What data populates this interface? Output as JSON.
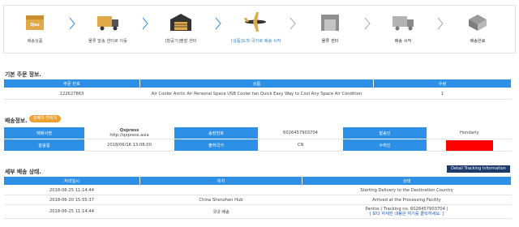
{
  "steps": [
    {
      "label": "배송상품",
      "state": "done",
      "icon": "qoo10-box-icon"
    },
    {
      "label": "물류 발송 센터로 이동",
      "state": "done",
      "icon": "delivery-truck-icon"
    },
    {
      "label": "[항공기]출발 센터",
      "state": "done",
      "icon": "warehouse-icon"
    },
    {
      "label": "[상품]도착 국가로 배송 시작",
      "state": "done",
      "icon": "airplane-icon"
    },
    {
      "label": "물류 센터",
      "state": "pending",
      "icon": "distribution-center-icon"
    },
    {
      "label": "배송 시작",
      "state": "pending",
      "icon": "delivery-truck-icon"
    },
    {
      "label": "배송완료",
      "state": "pending",
      "icon": "delivered-box-icon"
    }
  ],
  "order_section": {
    "title": "기본 주문 정보.",
    "headers": [
      "주문 번호",
      "상품",
      "수량"
    ],
    "row": [
      "122627863",
      "Air Cooler Arctic Air Personal Space USB Cooler fan Quick Easy Way to Cool Any Space Air Condition",
      "1"
    ]
  },
  "delivery_info": {
    "title": "배송정보.",
    "badge": "판매자 연락처",
    "carrier_label": "택배사명",
    "carrier_name": "Qxpress",
    "carrier_url": "http://qxpress.asia",
    "tracking_label": "송장번호",
    "tracking_no": "6026457903704",
    "sender_label": "발송인",
    "sender_value": "Hondarly",
    "ship_date_label": "발송일",
    "ship_date": "2018/06/16 13:08:00",
    "origin_label": "출하국가",
    "origin": "CN",
    "recipient_label": "수취인"
  },
  "status_section": {
    "title": "세부 배송 상태.",
    "detail_button": "Detail Tracking Information",
    "headers": [
      "처리일시",
      "위치",
      "상태"
    ],
    "rows": [
      {
        "time": "2018-06-25 11:14:44",
        "location": "",
        "status": "Starting Delivery to the Destination Country"
      },
      {
        "time": "2018-06-20 15:55:37",
        "location": "China Shenzhen Hub",
        "status": "Arrived at the Processing Facility"
      },
      {
        "time": "2018-06-25 11:14:44",
        "location": "국내 배송",
        "status": "Pantos ( Tracking no. 6026457903704 )",
        "status_link": "[ 보다 자세한 내용은 여기를 클릭하세요. ]"
      }
    ]
  },
  "colors": {
    "header_blue": "#2e8fe6",
    "active_blue": "#2e86d9",
    "badge_orange": "#f0a030",
    "redacted": "#ff0000",
    "detail_button": "#1c3a6b"
  }
}
